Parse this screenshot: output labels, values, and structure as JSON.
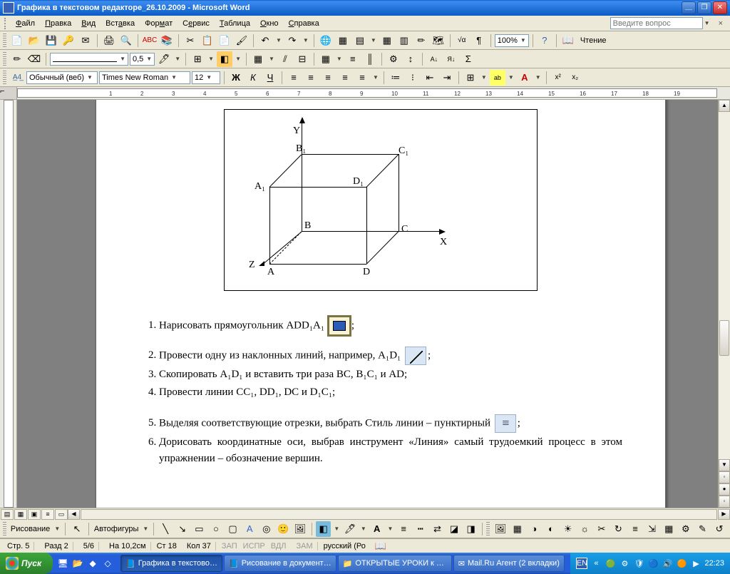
{
  "title": "Графика в текстовом редакторе_26.10.2009 - Microsoft Word",
  "menu": [
    "Файл",
    "Правка",
    "Вид",
    "Вставка",
    "Формат",
    "Сервис",
    "Таблица",
    "Окно",
    "Справка"
  ],
  "ask_placeholder": "Введите вопрос",
  "zoom": "100%",
  "reading": "Чтение",
  "line_weight": "0,5",
  "style": "Обычный (веб)",
  "font": "Times New Roman",
  "size": "12",
  "drawing_label": "Рисование",
  "autoshapes": "Автофигуры",
  "status": {
    "page": "Стр. 5",
    "section": "Разд 2",
    "pages": "5/6",
    "at": "На 10,2см",
    "line": "Ст 18",
    "col": "Кол 37",
    "rec": "ЗАП",
    "trk": "ИСПР",
    "ext": "ВДЛ",
    "ovr": "ЗАМ",
    "lang": "русский (Ро"
  },
  "diagram": {
    "axes": {
      "x": "X",
      "y": "Y",
      "z": "Z"
    },
    "labels": {
      "A": "A",
      "B": "B",
      "C": "C",
      "D": "D",
      "A1": "A₁",
      "B1": "B₁",
      "C1": "C₁",
      "D1": "D₁"
    }
  },
  "list": {
    "i1a": "Нарисовать прямоугольник ADD₁A₁ ",
    "i1b": ";",
    "i2a": "Провести одну из наклонных линий, например, A₁D₁ ",
    "i2b": ";",
    "i3": "Скопировать A₁D₁ и вставить три раза BC, B₁C₁ и AD;",
    "i4": "Провести линии CC₁, DD₁, DC и D₁C₁;",
    "i5a": "Выделяя соответствующие отрезки, выбрать Стиль линии – пунктирный ",
    "i5b": ";",
    "i6": "Дорисовать координатные оси, выбрав инструмент «Линия» самый трудоемкий процесс в этом упражнении – обозначение вершин."
  },
  "taskbar": {
    "start": "Пуск",
    "tasks": [
      "Графика в текстово…",
      "Рисование в документ…",
      "ОТКРЫТЫЕ УРОКИ к ат…",
      "Mail.Ru Агент (2 вкладки)"
    ],
    "lang": "EN",
    "time": "22:23"
  }
}
